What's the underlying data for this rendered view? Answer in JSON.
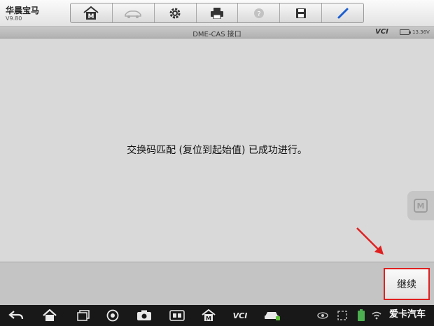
{
  "app": {
    "title": "华晨宝马",
    "version": "V9.80"
  },
  "toolbar": {
    "items": [
      {
        "name": "home-icon",
        "label": "M"
      },
      {
        "name": "vehicle-swap-icon"
      },
      {
        "name": "settings-icon"
      },
      {
        "name": "print-icon"
      },
      {
        "name": "help-icon"
      },
      {
        "name": "save-icon"
      },
      {
        "name": "pen-icon"
      }
    ]
  },
  "subbar": {
    "title": "DME-CAS 接口",
    "vci": "VCI",
    "voltage": "13.36V"
  },
  "main": {
    "message": "交换码匹配 (复位到起始值) 已成功进行。",
    "side_button": "M"
  },
  "actions": {
    "continue_label": "继续"
  },
  "navbar": {
    "vci_label": "VCI",
    "watermark": "爱卡汽车"
  },
  "colors": {
    "highlight_border": "#e02020",
    "arrow": "#e02020"
  }
}
